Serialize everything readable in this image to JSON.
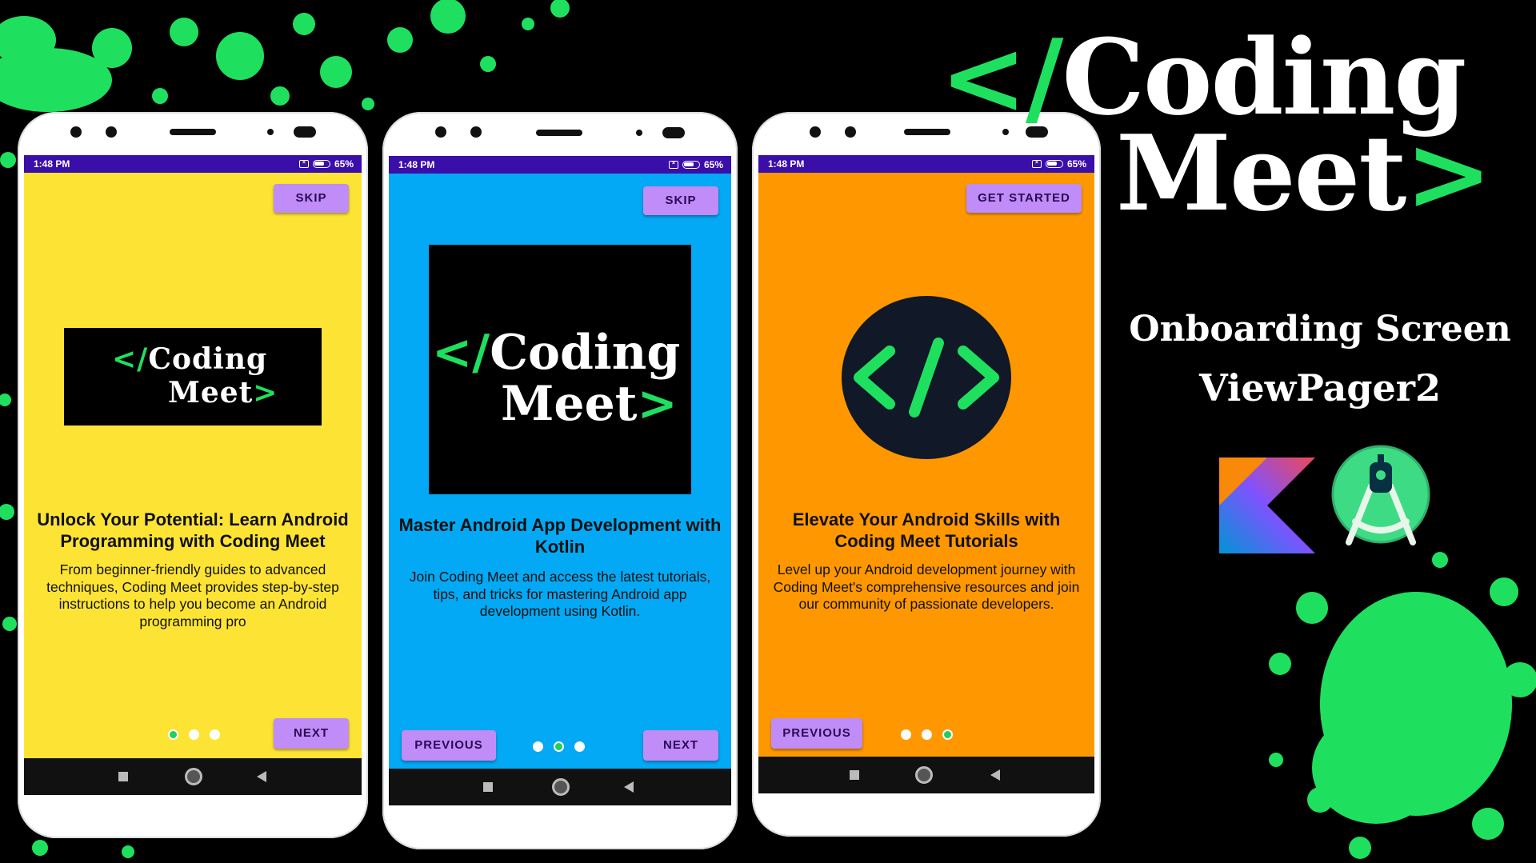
{
  "brand": {
    "open": "</",
    "line1": "Coding",
    "line2": "Meet",
    "close": ">"
  },
  "right_panel": {
    "line1": "Onboarding Screen",
    "line2": "ViewPager2"
  },
  "phones": [
    {
      "status": {
        "time": "1:48 PM",
        "battery": "65%"
      },
      "bg": "#fde434",
      "top_button": "SKIP",
      "title": "Unlock Your Potential: Learn Android Programming with Coding Meet",
      "description": "From beginner-friendly guides to advanced techniques, Coding Meet provides step-by-step instructions to help you become an Android programming pro",
      "next_button": "NEXT",
      "page_index": 0
    },
    {
      "status": {
        "time": "1:48 PM",
        "battery": "65%"
      },
      "bg": "#03a9f4",
      "top_button": "SKIP",
      "title": "Master Android App Development with Kotlin",
      "description": "Join Coding Meet and access the latest tutorials, tips, and tricks for mastering Android app development using Kotlin.",
      "prev_button": "PREVIOUS",
      "next_button": "NEXT",
      "page_index": 1
    },
    {
      "status": {
        "time": "1:48 PM",
        "battery": "65%"
      },
      "bg": "#ff9800",
      "top_button": "GET STARTED",
      "title": "Elevate Your Android Skills with Coding Meet Tutorials",
      "description": "Level up your Android development journey with Coding Meet's comprehensive resources and join our community of passionate developers.",
      "prev_button": "PREVIOUS",
      "page_index": 2
    }
  ],
  "colors": {
    "accent_green": "#1fe05e",
    "button_purple": "#c08cf7",
    "status_bar": "#3a0ea8"
  },
  "icons": [
    "kotlin-logo-icon",
    "android-studio-logo-icon",
    "code-brackets-icon"
  ]
}
